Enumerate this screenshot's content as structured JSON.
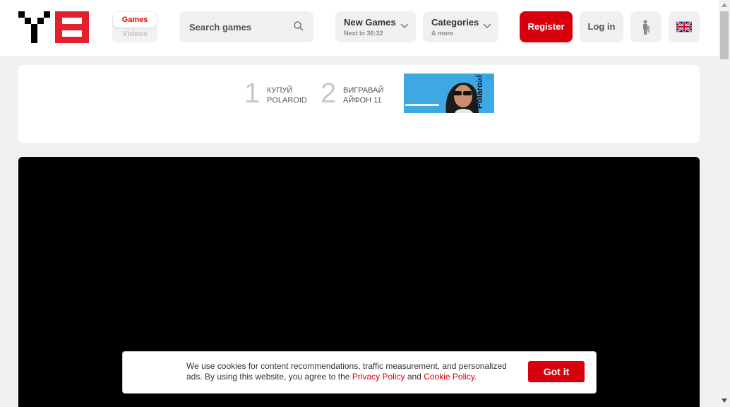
{
  "header": {
    "switch": {
      "games": "Games",
      "videos": "Videos"
    },
    "search": {
      "placeholder": "Search games"
    },
    "new_games": {
      "title": "New Games",
      "subtitle": "Next in 36:32"
    },
    "categories": {
      "title": "Categories",
      "subtitle": "& more"
    },
    "register": "Register",
    "login": "Log in"
  },
  "ad": {
    "step1_num": "1",
    "step1_line1": "КУПУЙ",
    "step1_line2": "POLAROID",
    "step2_num": "2",
    "step2_line1": "ВИГРАВАЙ",
    "step2_line2": "АЙФОН 11",
    "brand": "Polaroid"
  },
  "cookie": {
    "text_before": "We use cookies for content recommendations, traffic measurement, and personalized ads. By using this website, you agree to the ",
    "privacy": "Privacy Policy",
    "and": " and ",
    "cookie_policy": "Cookie Policy",
    "end": ".",
    "button": "Got it"
  },
  "colors": {
    "accent": "#d7000d",
    "player_bg": "#000000"
  },
  "icons": [
    "search-icon",
    "chevron-down-icon",
    "accessibility-icon",
    "uk-flag-icon",
    "ad-info-icon",
    "ad-close-icon"
  ]
}
